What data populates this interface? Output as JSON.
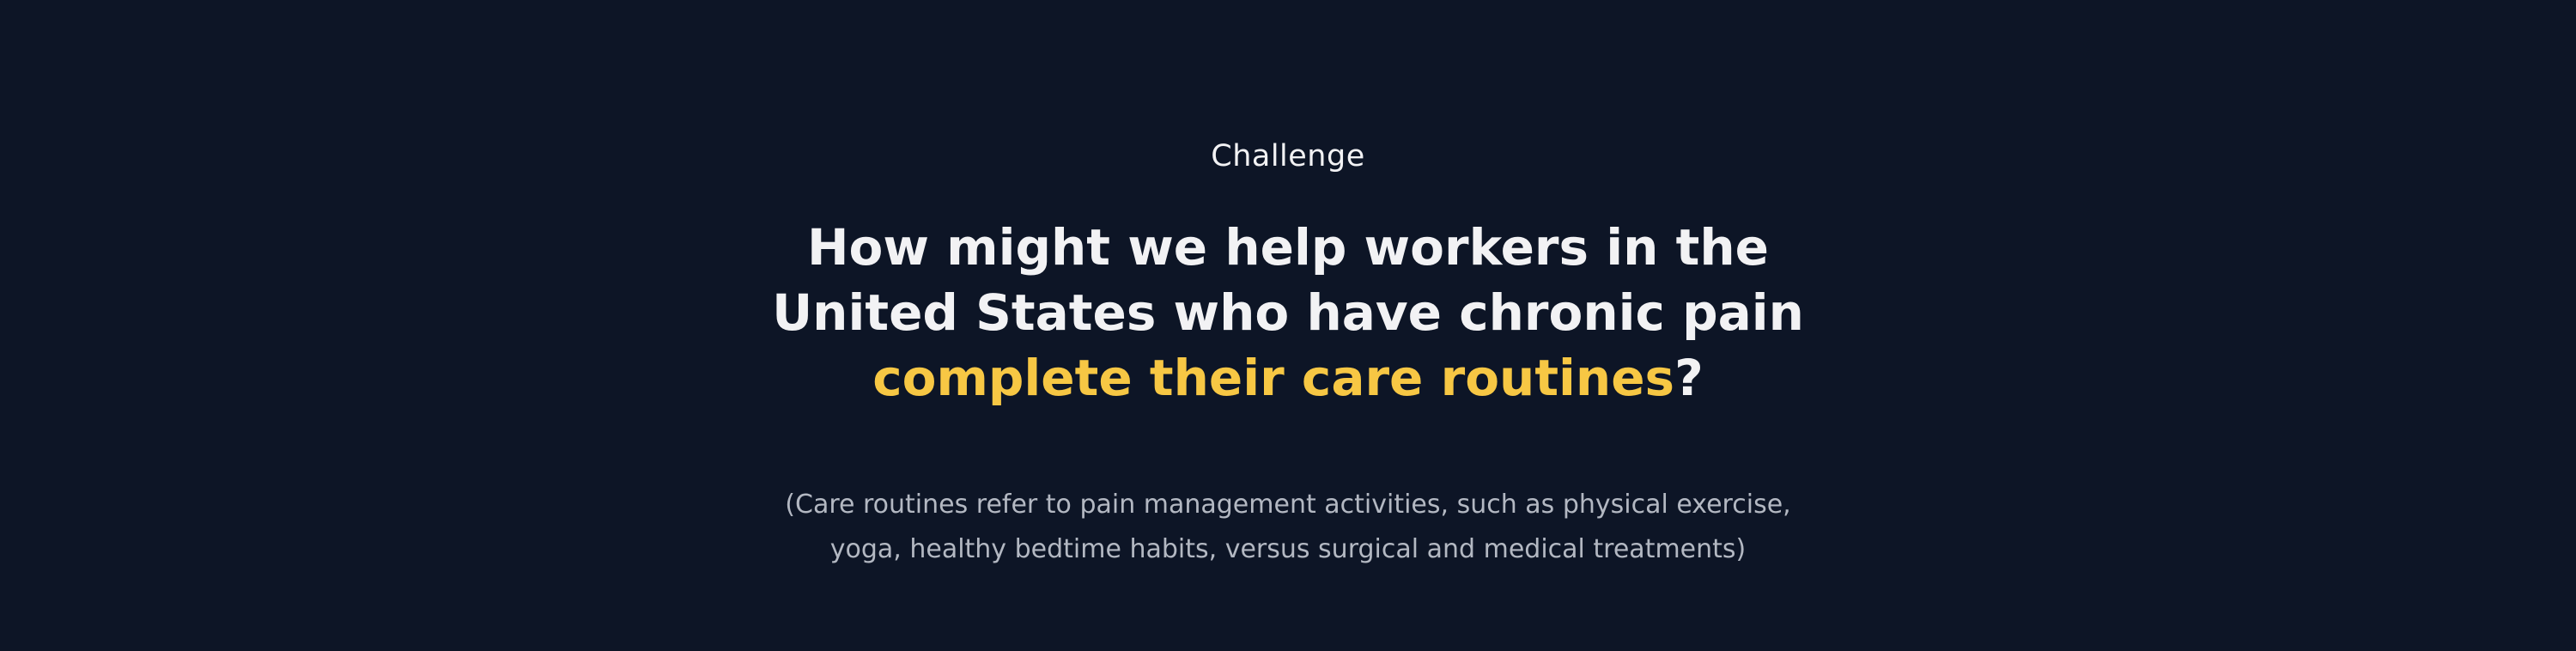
{
  "colors": {
    "background": "#0d1526",
    "heading_text": "#f2f2f4",
    "accent": "#f7c744",
    "muted_text": "#b3b8c2"
  },
  "challenge": {
    "eyebrow": "Challenge",
    "headline": {
      "line1": "How might we help workers in the",
      "line2": "United States who have chronic pain",
      "line3_highlight": "complete their care routines",
      "line3_tail": "?"
    },
    "note": {
      "line1": "(Care routines refer to pain management activities, such as physical exercise,",
      "line2": "yoga, healthy bedtime habits, versus surgical and medical treatments)"
    }
  }
}
